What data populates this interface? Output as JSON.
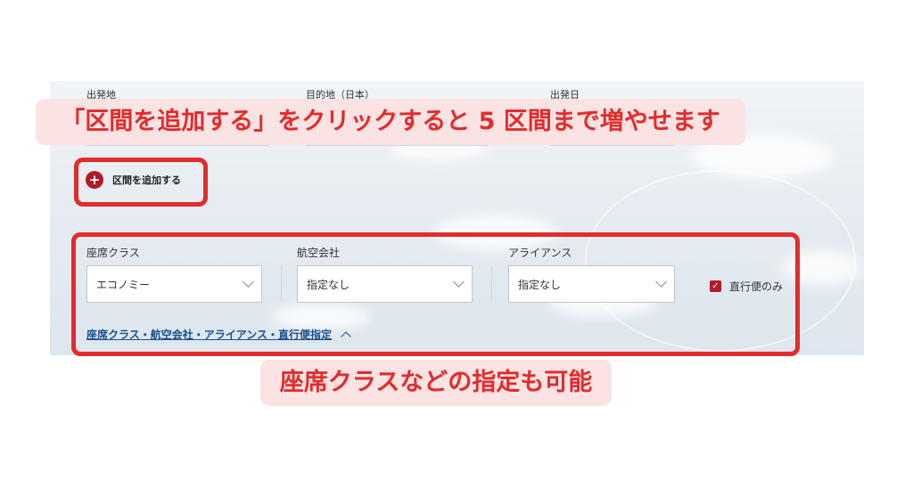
{
  "search_form": {
    "origin_label": "出発地",
    "destination_label": "目的地（日本）",
    "departure_date_label": "出発日",
    "add_segment_label": "区間を追加する",
    "add_icon": "plus-circle-icon"
  },
  "options": {
    "seat_class": {
      "label": "座席クラス",
      "value": "エコノミー"
    },
    "airline": {
      "label": "航空会社",
      "value": "指定なし"
    },
    "alliance": {
      "label": "アライアンス",
      "value": "指定なし"
    },
    "nonstop": {
      "label": "直行便のみ",
      "checked": true
    },
    "toggle_link": "座席クラス・航空会社・アライアンス・直行便指定"
  },
  "annotations": {
    "top": "「区間を追加する」をクリックすると 5 区間まで増やせます",
    "bottom": "座席クラスなどの指定も可能"
  },
  "colors": {
    "annotation_red": "#e32b2b",
    "annotation_bg": "#fbe3e3",
    "brand_red": "#b11a2a",
    "link_blue": "#1a4f8c"
  }
}
